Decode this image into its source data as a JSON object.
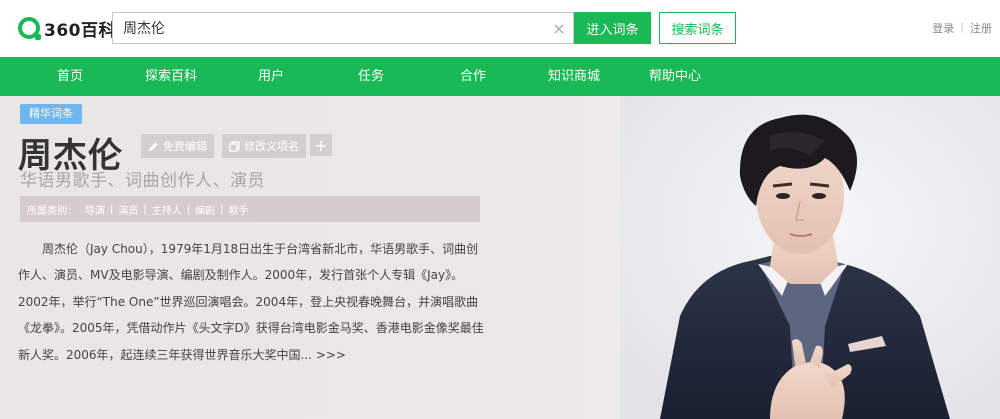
{
  "header": {
    "logo_text": "360百科",
    "search_value": "周杰伦",
    "clear_icon": "×",
    "enter_button": "进入词条",
    "search_button": "搜索词条",
    "login": "登录",
    "separator": "|",
    "register": "注册"
  },
  "nav": {
    "items": [
      "首页",
      "探索百科",
      "用户",
      "任务",
      "合作",
      "知识商城",
      "帮助中心"
    ]
  },
  "entry": {
    "badge": "精华词条",
    "title": "周杰伦",
    "edit_button": "免费编辑",
    "modify_button": "修改义项名",
    "add_icon": "+",
    "subtitle": "华语男歌手、词曲创作人、演员",
    "category_label": "所属类别：",
    "categories": [
      "导演",
      "演员",
      "主持人",
      "编剧",
      "歌手"
    ],
    "category_separator": "|",
    "summary": "周杰伦（Jay Chou），1979年1月18日出生于台湾省新北市，华语男歌手、词曲创作人、演员、MV及电影导演、编剧及制作人。2000年，发行首张个人专辑《Jay》。2002年，举行“The One”世界巡回演唱会。2004年，登上央视春晚舞台，并演唱歌曲《龙拳》。2005年，凭借动作片《头文字D》获得台湾电影金马奖、香港电影金像奖最佳新人奖。2006年，起连续三年获得世界音乐大奖中国...",
    "more_link": ">>>"
  },
  "colors": {
    "brand_green": "#19b955",
    "badge_blue": "#6fb6ee",
    "category_bar": "#d6cccb"
  },
  "icons": {
    "edit": "pencil-icon",
    "modify": "copy-icon",
    "add": "plus-icon",
    "clear": "close-icon",
    "logo": "360-logo-icon"
  }
}
